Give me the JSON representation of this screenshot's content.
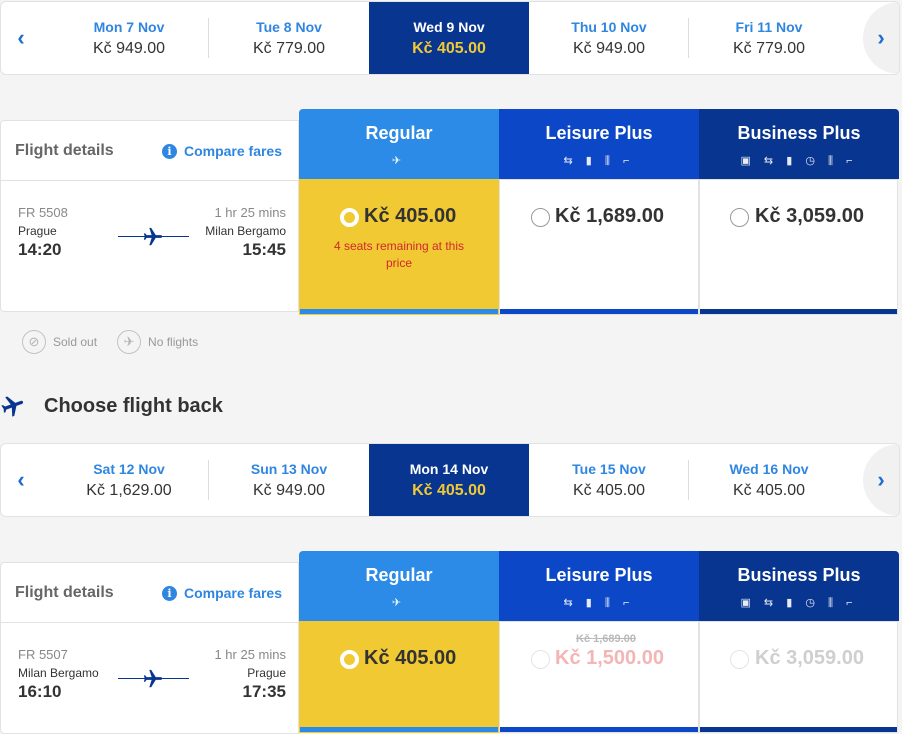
{
  "outbound": {
    "dates": [
      {
        "label": "Mon 7 Nov",
        "price": "Kč 949.00",
        "selected": false
      },
      {
        "label": "Tue 8 Nov",
        "price": "Kč 779.00",
        "selected": false
      },
      {
        "label": "Wed 9 Nov",
        "price": "Kč 405.00",
        "selected": true
      },
      {
        "label": "Thu 10 Nov",
        "price": "Kč 949.00",
        "selected": false
      },
      {
        "label": "Fri 11 Nov",
        "price": "Kč 779.00",
        "selected": false
      }
    ],
    "details_title": "Flight details",
    "compare_fares": "Compare fares",
    "flight": {
      "number": "FR 5508",
      "from": "Prague",
      "departure": "14:20",
      "duration": "1 hr 25 mins",
      "to": "Milan Bergamo",
      "arrival": "15:45"
    },
    "fares": {
      "regular": {
        "name": "Regular",
        "price": "Kč 405.00",
        "note": "4 seats remaining at this price"
      },
      "leisure": {
        "name": "Leisure Plus",
        "price": "Kč 1,689.00"
      },
      "business": {
        "name": "Business Plus",
        "price": "Kč 3,059.00"
      }
    }
  },
  "legend": {
    "sold_out": "Sold out",
    "no_flights": "No flights"
  },
  "return_title": "Choose flight back",
  "inbound": {
    "dates": [
      {
        "label": "Sat 12 Nov",
        "price": "Kč 1,629.00",
        "selected": false
      },
      {
        "label": "Sun 13 Nov",
        "price": "Kč 949.00",
        "selected": false
      },
      {
        "label": "Mon 14 Nov",
        "price": "Kč 405.00",
        "selected": true
      },
      {
        "label": "Tue 15 Nov",
        "price": "Kč 405.00",
        "selected": false
      },
      {
        "label": "Wed 16 Nov",
        "price": "Kč 405.00",
        "selected": false
      }
    ],
    "details_title": "Flight details",
    "compare_fares": "Compare fares",
    "flight": {
      "number": "FR 5507",
      "from": "Milan Bergamo",
      "departure": "16:10",
      "duration": "1 hr 25 mins",
      "to": "Prague",
      "arrival": "17:35"
    },
    "fares": {
      "regular": {
        "name": "Regular",
        "price": "Kč 405.00"
      },
      "leisure": {
        "name": "Leisure Plus",
        "old_price": "Kč 1,689.00",
        "price": "Kč 1,500.00"
      },
      "business": {
        "name": "Business Plus",
        "price": "Kč 3,059.00"
      }
    }
  },
  "icons": {
    "prev_arrow": "chevron-left-icon",
    "next_arrow": "chevron-right-icon",
    "info": "info-icon",
    "plane": "plane-icon",
    "sold_out": "sold-out-icon",
    "no_flights": "no-flights-icon",
    "regular_icons": "plane-icon",
    "leisure_icons": "flight-change-icon bag-icon priority-icon seat-icon",
    "business_icons": "ticket-icon flight-change-icon bag-icon clock-icon priority-icon seat-icon"
  },
  "colors": {
    "brand_dark": "#073590",
    "brand_mid": "#0c47c7",
    "brand_light": "#2c8be6",
    "accent_yellow": "#f1c933",
    "alert_red": "#d0282e"
  }
}
